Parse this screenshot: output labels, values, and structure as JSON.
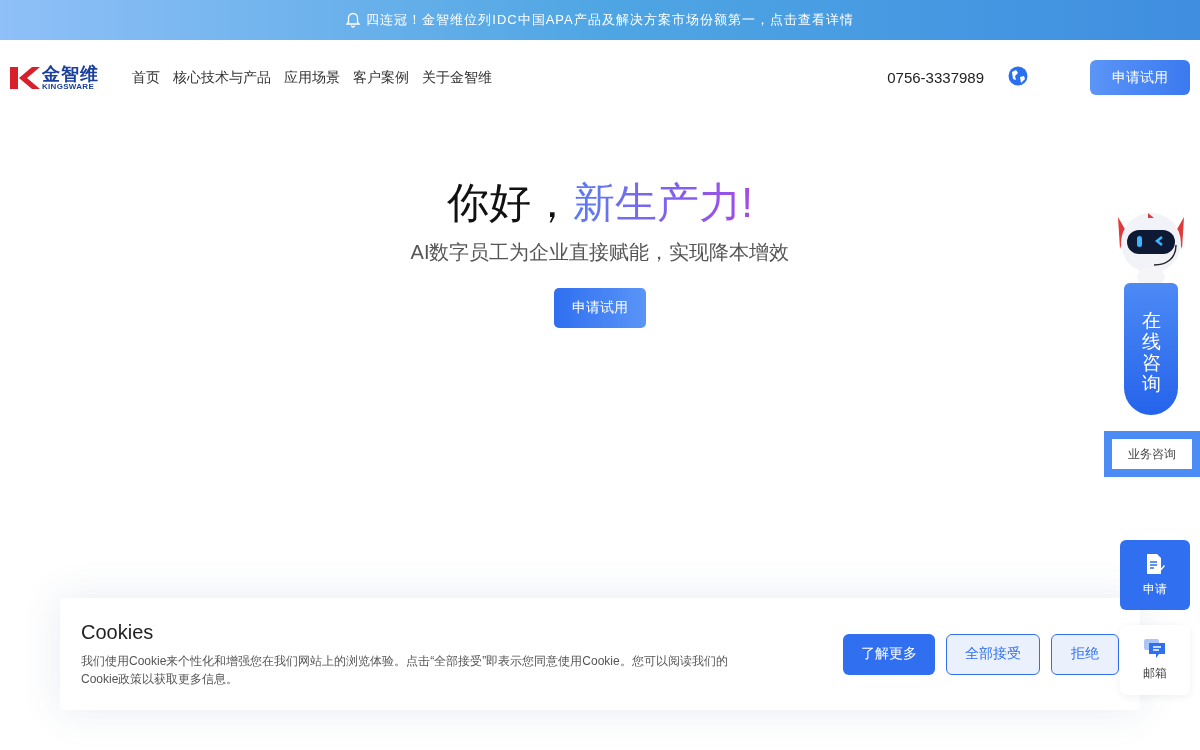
{
  "announcement": {
    "text": "四连冠！金智维位列IDC中国APA产品及解决方案市场份额第一，点击查看详情"
  },
  "header": {
    "logo": {
      "name": "金智维",
      "subtitle": "KINGSWARE"
    },
    "nav": [
      {
        "label": "首页"
      },
      {
        "label": "核心技术与产品"
      },
      {
        "label": "应用场景"
      },
      {
        "label": "客户案例"
      },
      {
        "label": "关于金智维"
      }
    ],
    "phone": "0756-3337989",
    "trial_button": "申请试用"
  },
  "hero": {
    "title": "你好，",
    "title_highlight": "新生产力!",
    "subtitle": "AI数字员工为企业直接赋能，实现降本增效",
    "button": "申请试用"
  },
  "side": {
    "chat_label": "在线咨询",
    "business_button": "业务咨询",
    "apply_button": "申请",
    "mail_button": "邮箱"
  },
  "cookie": {
    "title": "Cookies",
    "text": "我们使用Cookie来个性化和增强您在我们网站上的浏览体验。点击“全部接受”即表示您同意使用Cookie。您可以阅读我们的Cookie政策以获取更多信息。",
    "buttons": [
      {
        "label": "了解更多",
        "kind": "primary"
      },
      {
        "label": "全部接受",
        "kind": "outline"
      },
      {
        "label": "拒绝",
        "kind": "outline"
      }
    ]
  }
}
